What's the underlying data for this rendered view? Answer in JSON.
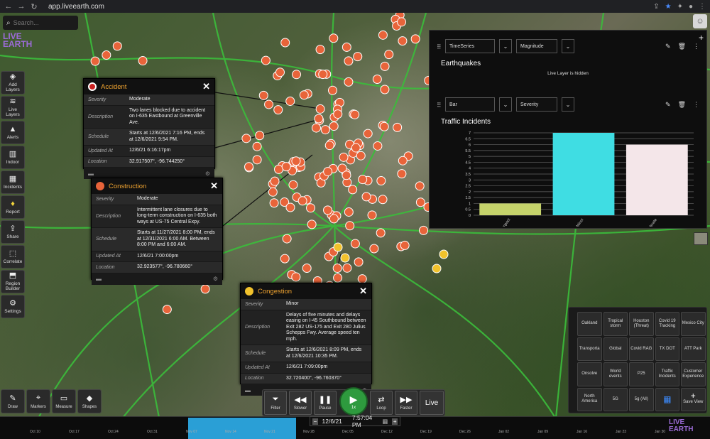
{
  "browser": {
    "url": "app.liveearth.com"
  },
  "search": {
    "placeholder": "Search..."
  },
  "logo": {
    "line1": "LIVE",
    "line2": "EARTH"
  },
  "left_tools": [
    {
      "label": "Add Layers",
      "icon": "add-layers-icon"
    },
    {
      "label": "Live Layers",
      "icon": "layers-icon"
    },
    {
      "label": "Alerts",
      "icon": "warning-icon"
    },
    {
      "label": "Indoor",
      "icon": "building-icon"
    },
    {
      "label": "Incidents",
      "icon": "incidents-icon"
    },
    {
      "label": "Report",
      "icon": "lightbulb-icon"
    },
    {
      "label": "Share",
      "icon": "share-icon"
    },
    {
      "label": "Correlate",
      "icon": "correlate-icon"
    },
    {
      "label": "Region Builder",
      "icon": "region-icon"
    },
    {
      "label": "Settings",
      "icon": "gear-icon"
    }
  ],
  "popups": {
    "accident": {
      "title": "Accident",
      "rows": [
        {
          "k": "Severity",
          "v": "Moderate"
        },
        {
          "k": "Description",
          "v": "Two lanes blocked due to accident on I-635 Eastbound at Greenville Ave."
        },
        {
          "k": "Schedule",
          "v": "Starts at 12/6/2021 7:16 PM, ends at 12/6/2021 9:54 PM."
        },
        {
          "k": "Updated At",
          "v": "12/6/21 6:16:17pm"
        },
        {
          "k": "Location",
          "v": "32.917507°, -96.744250°"
        }
      ]
    },
    "construction": {
      "title": "Construction",
      "rows": [
        {
          "k": "Severity",
          "v": "Moderate"
        },
        {
          "k": "Description",
          "v": "Intermittent lane closures due to long-term construction on I-635 both ways at US-75 Central Expy."
        },
        {
          "k": "Schedule",
          "v": "Starts at 11/27/2021 8:00 PM, ends at 12/31/2021 6:00 AM. Between 8:00 PM and 6:00 AM."
        },
        {
          "k": "Updated At",
          "v": "12/6/21 7:00:00pm"
        },
        {
          "k": "Location",
          "v": "32.923577°, -96.780660°"
        }
      ]
    },
    "congestion": {
      "title": "Congestion",
      "rows": [
        {
          "k": "Severity",
          "v": "Minor"
        },
        {
          "k": "Description",
          "v": "Delays of five minutes and delays easing on I-45 Southbound between Exit 282 US-175 and Exit 280 Julius Schepps Fwy. Average speed ten mph."
        },
        {
          "k": "Schedule",
          "v": "Starts at 12/6/2021 8:09 PM, ends at 12/6/2021 10:35 PM."
        },
        {
          "k": "Updated At",
          "v": "12/6/21 7:09:00pm"
        },
        {
          "k": "Location",
          "v": "32.720400°, -96.760370°"
        }
      ]
    }
  },
  "dashboard": {
    "widget1": {
      "select1": "TimeSeries",
      "select2": "Magnitude",
      "title": "Earthquakes",
      "message": "Live Layer is hidden"
    },
    "widget2": {
      "select1": "Bar",
      "select2": "Severity",
      "title": "Traffic Incidents"
    }
  },
  "chart_data": {
    "type": "bar",
    "title": "Traffic Incidents",
    "categories": [
      "Low Impact",
      "Minor",
      "Moderate"
    ],
    "values": [
      1,
      7,
      6
    ],
    "colors": [
      "#c5d36b",
      "#3fdde3",
      "#f4e6e9"
    ],
    "ylim": [
      0,
      7
    ],
    "yticks": [
      "0",
      "0.5",
      "1",
      "1.5",
      "2",
      "2.5",
      "3",
      "3.5",
      "4",
      "4.5",
      "5",
      "5.5",
      "6",
      "6.5",
      "7"
    ]
  },
  "bottom_tools": [
    {
      "label": "Draw",
      "icon": "pencil-icon"
    },
    {
      "label": "Markers",
      "icon": "marker-icon"
    },
    {
      "label": "Measure",
      "icon": "ruler-icon"
    },
    {
      "label": "Shapes",
      "icon": "shapes-icon"
    }
  ],
  "player": {
    "filter": "Filter",
    "slower": "Slower",
    "pause": "Pause",
    "play_speed": "1x",
    "loop": "Loop",
    "faster": "Faster",
    "live": "Live"
  },
  "timeline": {
    "date": "12/6/21",
    "time": "7:57:04 PM",
    "labels": [
      "Oct 10",
      "Oct 17",
      "Oct 24",
      "Oct 31",
      "Nov 07",
      "Nov 14",
      "Nov 21",
      "Nov 28",
      "Dec 05",
      "Dec 12",
      "Dec 19",
      "Dec 26",
      "Jan 02",
      "Jan 09",
      "Jan 16",
      "Jan 23",
      "Jan 30"
    ]
  },
  "favorites": [
    "Oakland",
    "Tropical storm",
    "Houston (Threat)",
    "Covid 19 Tracking",
    "Mexico City",
    "Transporta",
    "Global",
    "Covid RAG",
    "TX DOT",
    "ATT Park",
    "Onsolve",
    "World events",
    "P25",
    "Traffic Incidents",
    "Customer Experience",
    "North America",
    "5G",
    "5g (All)",
    "",
    "Save View"
  ],
  "colors": {
    "accent_orange": "#f2a531",
    "marker": "#e8643a",
    "play_green": "#2e9a3e",
    "timeline_blue": "#2a9fd6"
  }
}
